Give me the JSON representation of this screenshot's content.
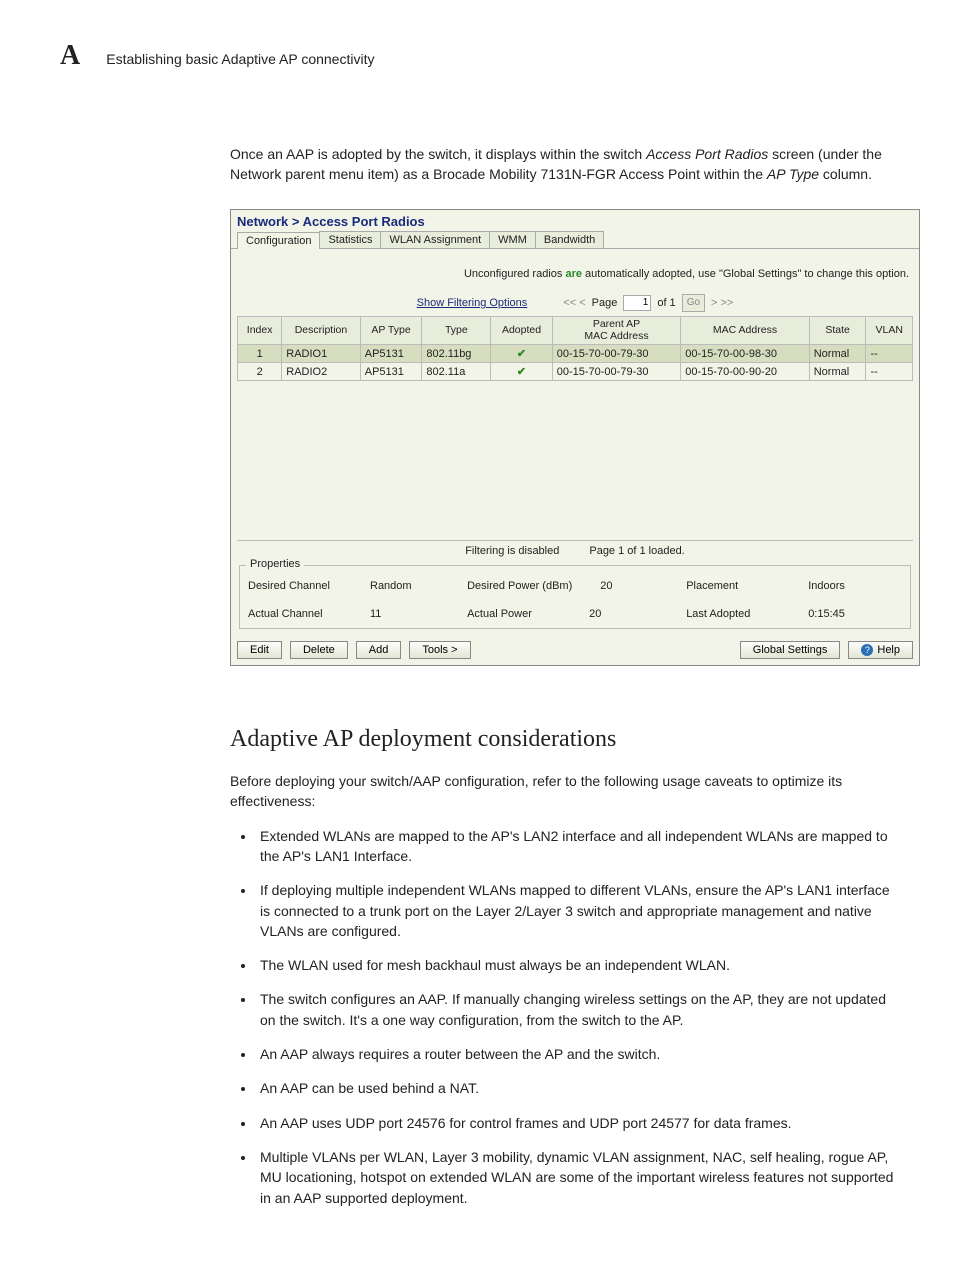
{
  "header": {
    "letter": "A",
    "title": "Establishing basic Adaptive AP connectivity"
  },
  "intro": {
    "p1a": "Once an AAP is adopted by the switch, it displays within the switch ",
    "p1b": "Access Port Radios",
    "p1c": " screen (under the Network parent menu item) as a Brocade Mobility 7131N-FGR Access Point within the ",
    "p1d": "AP Type",
    "p1e": " column."
  },
  "panel": {
    "breadcrumb": "Network > Access Port Radios",
    "tabs": [
      "Configuration",
      "Statistics",
      "WLAN Assignment",
      "WMM",
      "Bandwidth"
    ],
    "notice_a": "Unconfigured radios ",
    "notice_b": "are",
    "notice_c": " automatically adopted, use \"Global Settings\" to change this option.",
    "filter_link": "Show Filtering Options",
    "pager": {
      "prev": "<< <",
      "page_label": "Page",
      "page_value": "1",
      "of": "of 1",
      "go": "Go",
      "next": "> >>"
    },
    "columns": [
      "Index",
      "Description",
      "AP Type",
      "Type",
      "Adopted",
      "Parent AP\nMAC Address",
      "MAC Address",
      "State",
      "VLAN"
    ],
    "rows": [
      {
        "index": "1",
        "desc": "RADIO1",
        "aptype": "AP5131",
        "type": "802.11bg",
        "adopted": "✔",
        "parent": "00-15-70-00-79-30",
        "mac": "00-15-70-00-98-30",
        "state": "Normal",
        "vlan": "--"
      },
      {
        "index": "2",
        "desc": "RADIO2",
        "aptype": "AP5131",
        "type": "802.11a",
        "adopted": "✔",
        "parent": "00-15-70-00-79-30",
        "mac": "00-15-70-00-90-20",
        "state": "Normal",
        "vlan": "--"
      }
    ],
    "status_a": "Filtering is disabled",
    "status_b": "Page 1 of 1 loaded.",
    "props": {
      "legend": "Properties",
      "desired_channel_lbl": "Desired Channel",
      "desired_channel_val": "Random",
      "desired_power_lbl": "Desired Power (dBm)",
      "desired_power_val": "20",
      "placement_lbl": "Placement",
      "placement_val": "Indoors",
      "actual_channel_lbl": "Actual Channel",
      "actual_channel_val": "11",
      "actual_power_lbl": "Actual Power",
      "actual_power_val": "20",
      "last_adopted_lbl": "Last Adopted",
      "last_adopted_val": "0:15:45"
    },
    "buttons": {
      "edit": "Edit",
      "delete": "Delete",
      "add": "Add",
      "tools": "Tools >",
      "global": "Global Settings",
      "help": "Help"
    }
  },
  "section": {
    "heading": "Adaptive AP deployment considerations",
    "intro": "Before deploying your switch/AAP configuration, refer to the following usage caveats to optimize its effectiveness:",
    "bullets": [
      "Extended WLANs are mapped to the AP's LAN2 interface and all independent WLANs are mapped to the AP's LAN1 Interface.",
      "If deploying multiple independent WLANs mapped to different VLANs, ensure the AP's LAN1 interface is connected to a trunk port on the Layer 2/Layer 3 switch and appropriate management and native VLANs are configured.",
      "The WLAN used for mesh backhaul must always be an independent WLAN.",
      "The switch configures an AAP. If manually changing wireless settings on the AP, they are not updated on the switch. It's a one way configuration, from the switch to the AP.",
      "An AAP always requires a router between the AP and the switch.",
      "An AAP can be used behind a NAT.",
      "An AAP uses UDP port 24576 for control frames and UDP port 24577 for data frames.",
      "Multiple VLANs per WLAN, Layer 3 mobility, dynamic VLAN assignment, NAC, self healing, rogue AP, MU locationing, hotspot on extended WLAN are some of the important wireless features not supported in an AAP supported deployment."
    ]
  }
}
